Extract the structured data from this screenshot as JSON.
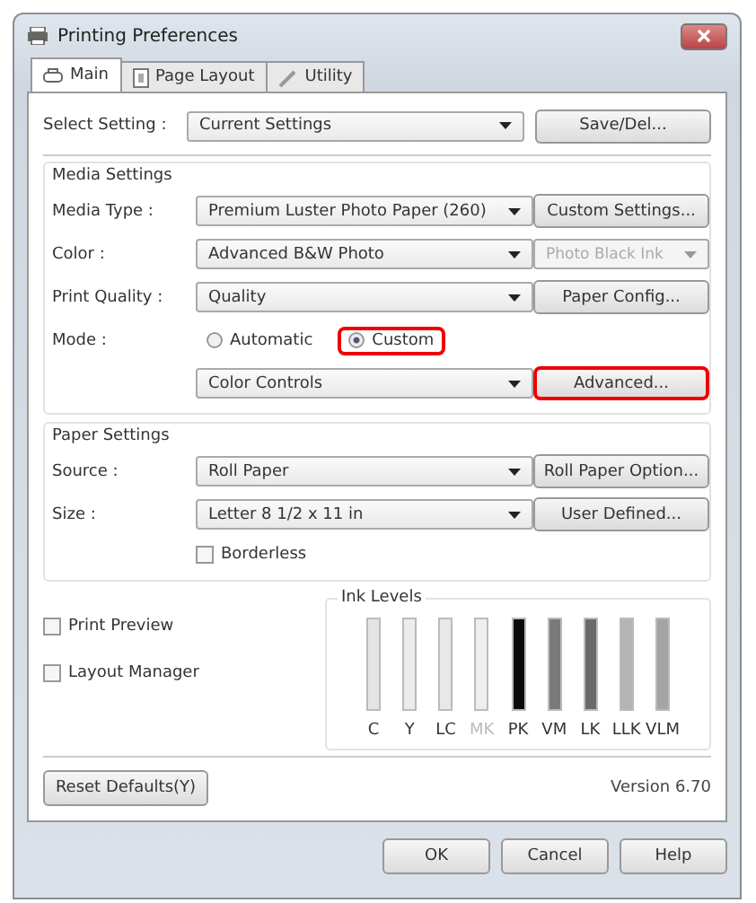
{
  "window": {
    "title": "Printing Preferences"
  },
  "tabs": [
    {
      "label": "Main",
      "selected": true,
      "kind": "printer"
    },
    {
      "label": "Page Layout",
      "selected": false,
      "kind": "page"
    },
    {
      "label": "Utility",
      "selected": false,
      "kind": "pencil"
    }
  ],
  "select_setting": {
    "label": "Select Setting :",
    "value": "Current Settings",
    "button": "Save/Del..."
  },
  "media_settings": {
    "title": "Media Settings",
    "rows": [
      {
        "kind": "select",
        "label": "Media Type :",
        "value": "Premium Luster Photo Paper (260)",
        "side": {
          "kind": "button",
          "label": "Custom Settings...",
          "disabled": false,
          "highlighted": false
        }
      },
      {
        "kind": "select",
        "label": "Color :",
        "value": "Advanced B&W Photo",
        "side": {
          "kind": "select",
          "label": "Photo Black Ink",
          "disabled": true,
          "highlighted": false
        }
      },
      {
        "kind": "select",
        "label": "Print Quality :",
        "value": "Quality",
        "side": {
          "kind": "button",
          "label": "Paper Config...",
          "disabled": false,
          "highlighted": false
        }
      },
      {
        "kind": "radios",
        "label": "Mode :",
        "options": [
          {
            "label": "Automatic",
            "selected": false,
            "highlighted": false
          },
          {
            "label": "Custom",
            "selected": true,
            "highlighted": true
          }
        ]
      },
      {
        "kind": "select",
        "value": "Color Controls",
        "side": {
          "kind": "button",
          "label": "Advanced...",
          "disabled": false,
          "highlighted": true
        }
      }
    ]
  },
  "paper_settings": {
    "title": "Paper Settings",
    "rows": [
      {
        "kind": "select",
        "label": "Source :",
        "value": "Roll Paper",
        "side": {
          "kind": "button",
          "label": "Roll Paper Option...",
          "disabled": false,
          "highlighted": false
        }
      },
      {
        "kind": "select",
        "label": "Size :",
        "value": "Letter 8 1/2 x 11 in",
        "side": {
          "kind": "button",
          "label": "User Defined...",
          "disabled": false,
          "highlighted": false
        }
      },
      {
        "kind": "checkbox",
        "label": "Borderless",
        "checked": false
      }
    ]
  },
  "options": [
    {
      "label": "Print Preview",
      "checked": false
    },
    {
      "label": "Layout Manager",
      "checked": false
    }
  ],
  "ink_levels": {
    "title": "Ink Levels",
    "inks": [
      {
        "label": "C",
        "color": "#e4e4e4",
        "disabled": false
      },
      {
        "label": "Y",
        "color": "#ececec",
        "disabled": false
      },
      {
        "label": "LC",
        "color": "#e8e8e8",
        "disabled": false
      },
      {
        "label": "MK",
        "color": "#eeeeee",
        "disabled": true
      },
      {
        "label": "PK",
        "color": "#0a0a0a",
        "disabled": false
      },
      {
        "label": "VM",
        "color": "#7a7a7a",
        "disabled": false
      },
      {
        "label": "LK",
        "color": "#6a6a6a",
        "disabled": false
      },
      {
        "label": "LLK",
        "color": "#b4b4b4",
        "disabled": false
      },
      {
        "label": "VLM",
        "color": "#a4a4a4",
        "disabled": false
      }
    ]
  },
  "reset_button": "Reset Defaults(Y)",
  "version": "Version 6.70",
  "buttons": [
    "OK",
    "Cancel",
    "Help"
  ]
}
